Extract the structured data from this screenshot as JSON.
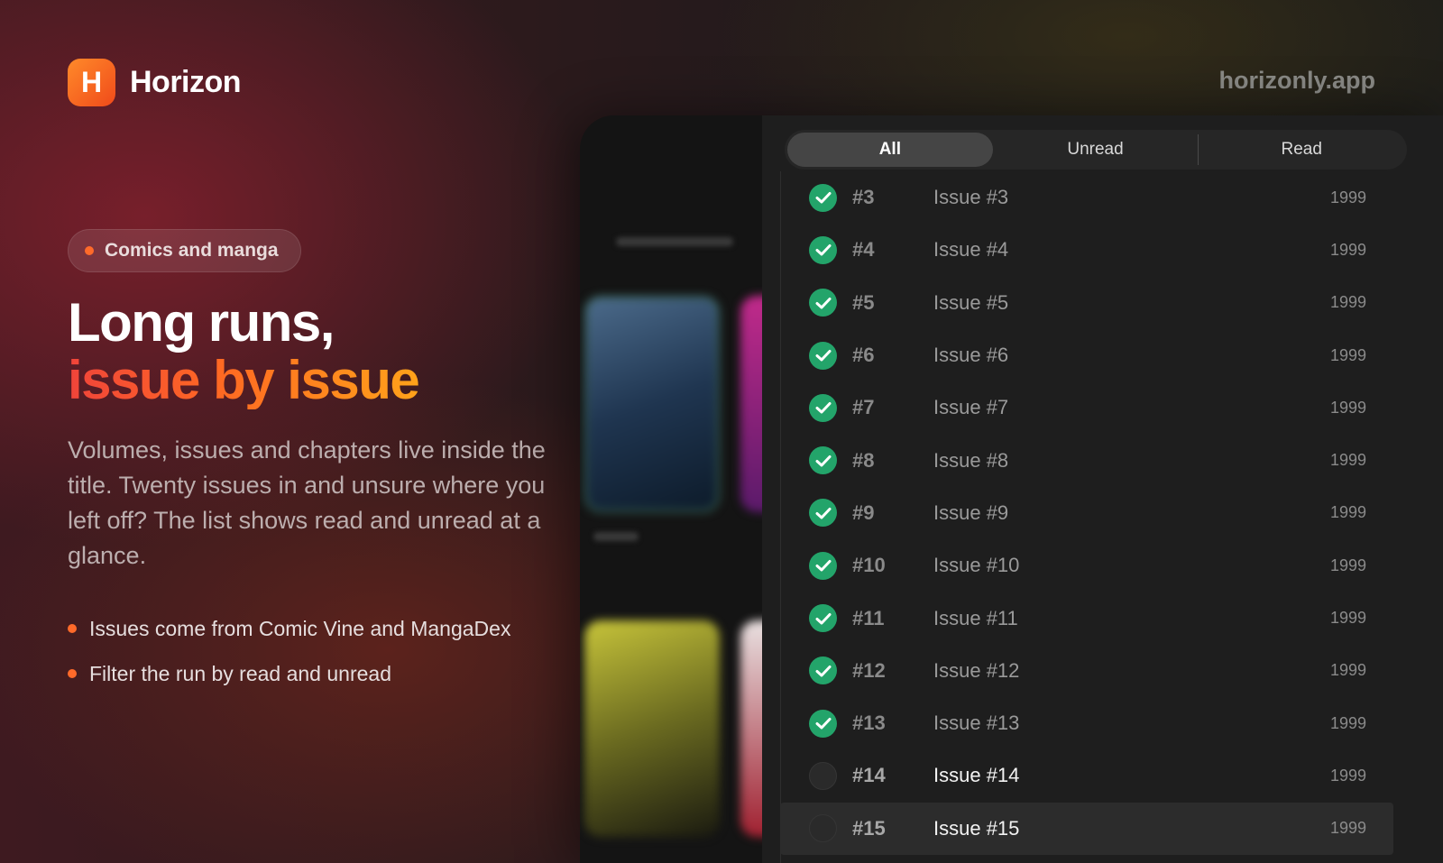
{
  "brand": {
    "logo_letter": "H",
    "name": "Horizon",
    "url": "horizonly.app",
    "accent": "#ff6a2a"
  },
  "hero": {
    "category_pill": "Comics and manga",
    "headline_line1": "Long runs,",
    "headline_line2": "issue by issue",
    "description": "Volumes, issues and chapters live inside the title. Twenty issues in and unsure where you left off? The list shows read and unread at a glance.",
    "bullets": [
      "Issues come from Comic Vine and MangaDex",
      "Filter the run by read and unread"
    ]
  },
  "filter_tabs": [
    {
      "label": "All",
      "active": true
    },
    {
      "label": "Unread",
      "active": false
    },
    {
      "label": "Read",
      "active": false
    }
  ],
  "issues": [
    {
      "number": "#3",
      "title": "Issue #3",
      "year": "1999",
      "read": true
    },
    {
      "number": "#4",
      "title": "Issue #4",
      "year": "1999",
      "read": true
    },
    {
      "number": "#5",
      "title": "Issue #5",
      "year": "1999",
      "read": true
    },
    {
      "number": "#6",
      "title": "Issue #6",
      "year": "1999",
      "read": true
    },
    {
      "number": "#7",
      "title": "Issue #7",
      "year": "1999",
      "read": true
    },
    {
      "number": "#8",
      "title": "Issue #8",
      "year": "1999",
      "read": true
    },
    {
      "number": "#9",
      "title": "Issue #9",
      "year": "1999",
      "read": true
    },
    {
      "number": "#10",
      "title": "Issue #10",
      "year": "1999",
      "read": true
    },
    {
      "number": "#11",
      "title": "Issue #11",
      "year": "1999",
      "read": true
    },
    {
      "number": "#12",
      "title": "Issue #12",
      "year": "1999",
      "read": true
    },
    {
      "number": "#13",
      "title": "Issue #13",
      "year": "1999",
      "read": true
    },
    {
      "number": "#14",
      "title": "Issue #14",
      "year": "1999",
      "read": false
    },
    {
      "number": "#15",
      "title": "Issue #15",
      "year": "1999",
      "read": false,
      "selected": true
    }
  ],
  "colors": {
    "read_check": "#23a46a",
    "headline_gradient": [
      "#f0443a",
      "#ff6a22",
      "#ffa21a"
    ]
  }
}
